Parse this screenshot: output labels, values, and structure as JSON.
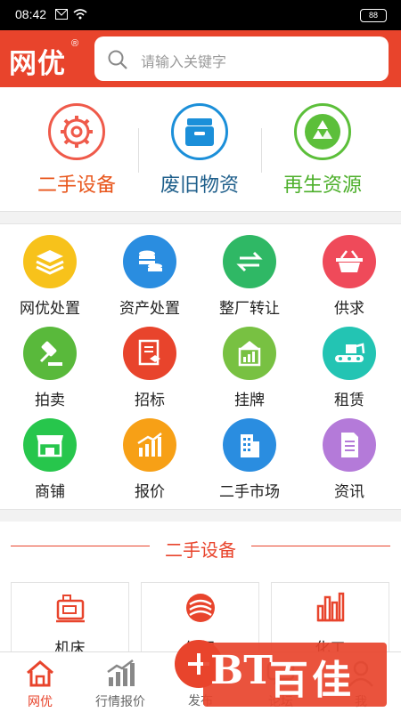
{
  "status": {
    "time": "08:42",
    "battery": "88"
  },
  "header": {
    "logo": "网优",
    "logo_reg": "®",
    "search_placeholder": "请输入关键字"
  },
  "top_categories": [
    {
      "label": "二手设备",
      "color": "#e8561c",
      "icon": "gear-icon"
    },
    {
      "label": "废旧物资",
      "color": "#1f5f8b",
      "icon": "storage-box-icon"
    },
    {
      "label": "再生资源",
      "color": "#4caf2a",
      "icon": "recycle-icon"
    }
  ],
  "grid": [
    {
      "label": "网优处置",
      "color": "#f7c21b",
      "icon": "layers-icon"
    },
    {
      "label": "资产处置",
      "color": "#2a8de0",
      "icon": "coins-icon"
    },
    {
      "label": "整厂转让",
      "color": "#2fb865",
      "icon": "transfer-arrows-icon"
    },
    {
      "label": "供求",
      "color": "#ef4a5a",
      "icon": "basket-icon"
    },
    {
      "label": "拍卖",
      "color": "#59b93b",
      "icon": "gavel-icon"
    },
    {
      "label": "招标",
      "color": "#e8442c",
      "icon": "document-icon"
    },
    {
      "label": "挂牌",
      "color": "#78c142",
      "icon": "chart-board-icon"
    },
    {
      "label": "租赁",
      "color": "#23c4b3",
      "icon": "excavator-icon"
    },
    {
      "label": "商铺",
      "color": "#27c64c",
      "icon": "shop-icon"
    },
    {
      "label": "报价",
      "color": "#f7a016",
      "icon": "bar-growth-icon"
    },
    {
      "label": "二手市场",
      "color": "#2a8de0",
      "icon": "building-icon"
    },
    {
      "label": "资讯",
      "color": "#b47ad9",
      "icon": "news-icon"
    }
  ],
  "section": {
    "title": "二手设备",
    "cards": [
      {
        "label": "机床",
        "icon": "machine-tool-icon"
      },
      {
        "label": "纺织",
        "icon": "textile-icon"
      },
      {
        "label": "化工",
        "icon": "chemical-plant-icon"
      }
    ]
  },
  "nav": {
    "items": [
      {
        "label": "网优",
        "icon": "home-icon"
      },
      {
        "label": "行情报价",
        "icon": "market-chart-icon"
      },
      {
        "label": "发布",
        "icon": "plus-icon"
      },
      {
        "label": "论坛",
        "icon": "forum-icon"
      },
      {
        "label": "我",
        "icon": "user-icon"
      }
    ],
    "active_color": "#e8442c"
  },
  "watermark": {
    "mark": "BT",
    "text": "百佳"
  }
}
